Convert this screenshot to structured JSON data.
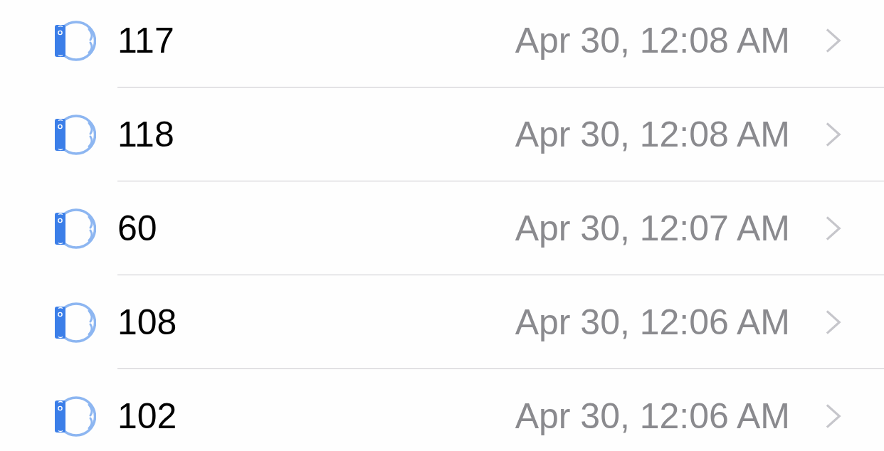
{
  "rows": [
    {
      "value": "117",
      "date": "Apr 30, 12:08 AM"
    },
    {
      "value": "118",
      "date": "Apr 30, 12:08 AM"
    },
    {
      "value": "60",
      "date": "Apr 30, 12:07 AM"
    },
    {
      "value": "108",
      "date": "Apr 30, 12:06 AM"
    },
    {
      "value": "102",
      "date": "Apr 30, 12:06 AM"
    }
  ]
}
